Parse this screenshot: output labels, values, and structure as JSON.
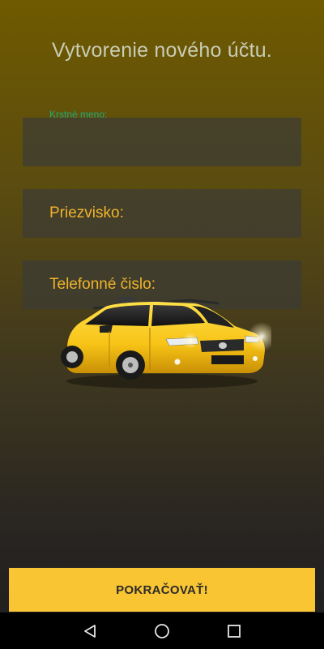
{
  "screen": {
    "title": "Vytvorenie nového účtu."
  },
  "form": {
    "first_name": {
      "label": "Krstné meno:",
      "value": "",
      "placeholder": ""
    },
    "last_name": {
      "value": "",
      "placeholder": "Priezvisko:"
    },
    "phone": {
      "value": "",
      "placeholder": "Telefonné čislo:"
    }
  },
  "image": {
    "subject": "taxi-car"
  },
  "actions": {
    "continue_label": "POKRAČOVAŤ!"
  },
  "navbar": {
    "back_icon": "back-triangle-icon",
    "home_icon": "home-circle-icon",
    "recent_icon": "recent-apps-square-icon"
  },
  "colors": {
    "accent": "#f9c532",
    "placeholder": "#f0b429",
    "floating_label": "#1faa7a",
    "title": "#c9cdb6",
    "field_bg": "#3c3c34"
  }
}
